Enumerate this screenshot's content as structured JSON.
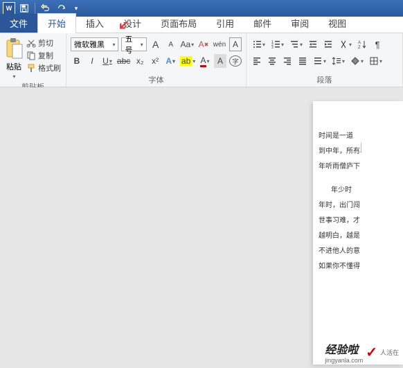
{
  "qat": {
    "app": "W"
  },
  "tabs": {
    "file": "文件",
    "home": "开始",
    "insert": "插入",
    "design": "设计",
    "layout": "页面布局",
    "references": "引用",
    "mailings": "邮件",
    "review": "审阅",
    "view": "视图"
  },
  "clipboard": {
    "paste": "粘贴",
    "cut": "剪切",
    "copy": "复制",
    "format_painter": "格式刷",
    "group_label": "剪贴板"
  },
  "font": {
    "name": "微软雅黑",
    "size": "五号",
    "grow": "A",
    "shrink": "A",
    "case": "Aa",
    "clear": "A",
    "pinyin": "拼",
    "charborder": "A",
    "bold": "B",
    "italic": "I",
    "underline": "U",
    "strike": "abc",
    "sub": "x₂",
    "sup": "x²",
    "texteffect": "A",
    "highlight": "ab",
    "color": "A",
    "charshade": "A",
    "enclosed": "字",
    "group_label": "字体"
  },
  "para": {
    "group_label": "段落"
  },
  "doc": {
    "p1": "时间是一道",
    "p2": "到中年，所有",
    "p3": "年听雨僧庐下",
    "p4": "年少时",
    "p5": "年时，出门闯",
    "p6": "世事习难，才",
    "p7": "越明白，越是",
    "p8": "不进他人的意",
    "p9": "如果你不懂得"
  },
  "watermark": {
    "brand": "经验啦",
    "url": "jingyanla.com",
    "tag": "人活在"
  }
}
